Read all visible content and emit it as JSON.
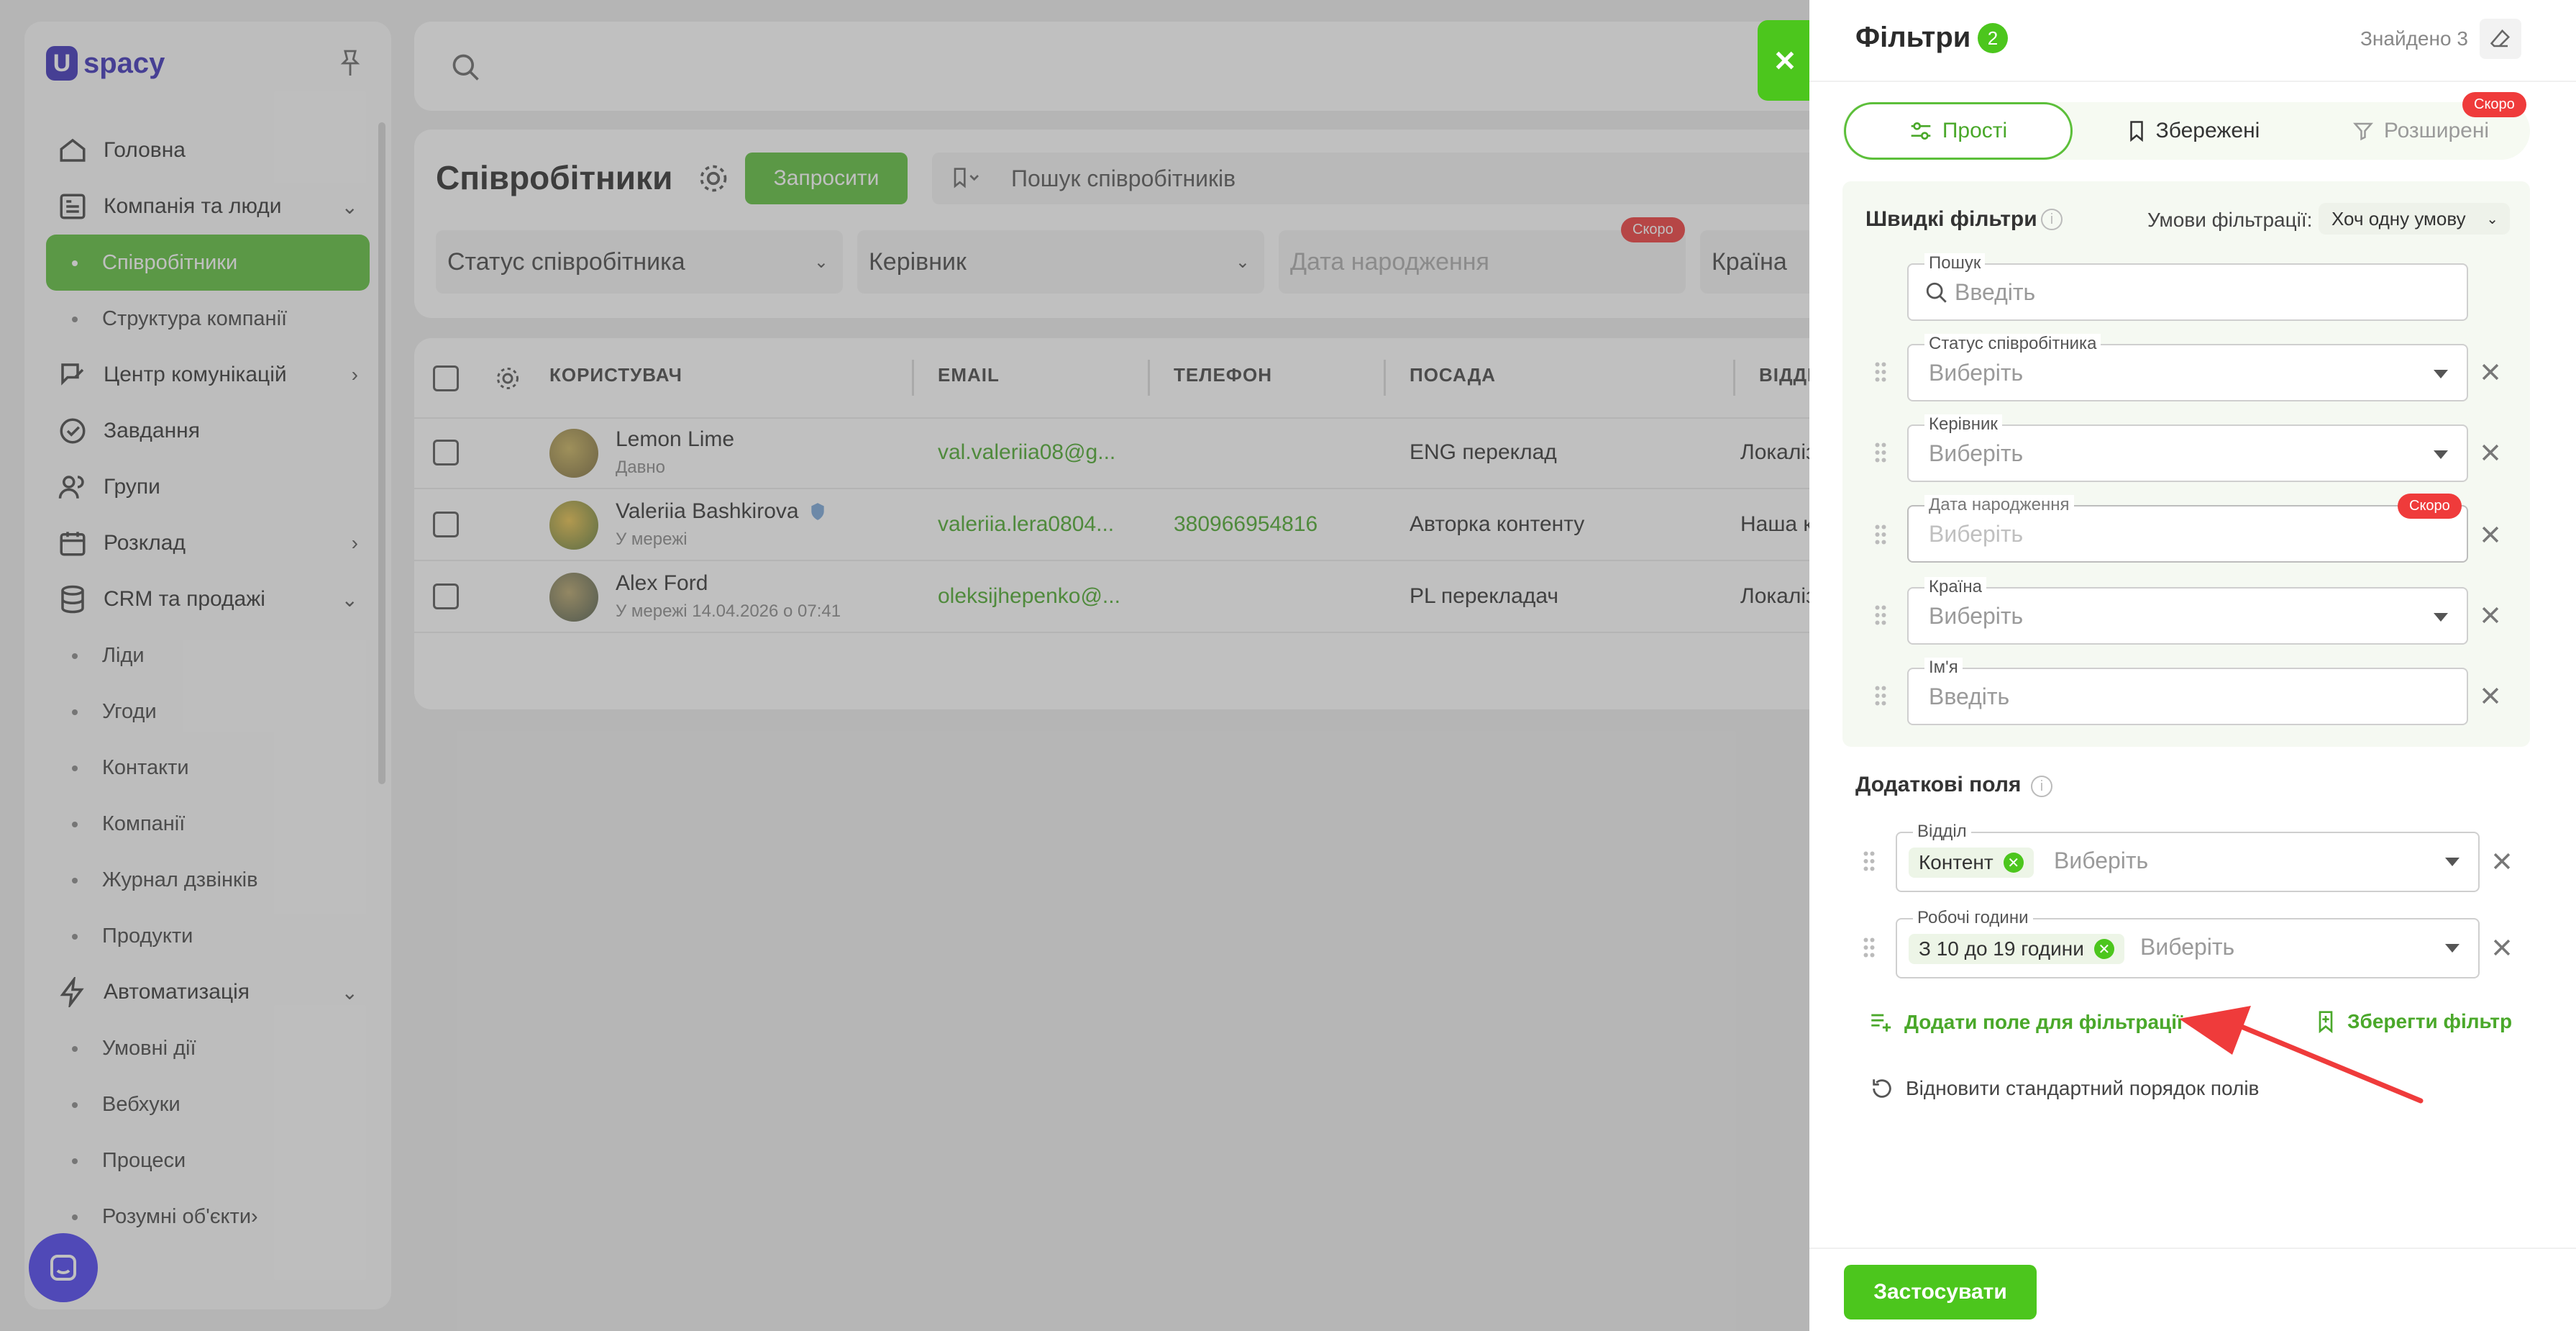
{
  "brand": {
    "logo_mark": "U",
    "logo_text": "spacy"
  },
  "sidebar": {
    "items": [
      {
        "label": "Головна",
        "icon": "home-icon",
        "type": "item"
      },
      {
        "label": "Компанія та люди",
        "icon": "building-icon",
        "type": "item",
        "chevron": "⌄"
      },
      {
        "label": "Співробітники",
        "type": "sub",
        "active": true
      },
      {
        "label": "Структура компанії",
        "type": "sub"
      },
      {
        "label": "Центр комунікацій",
        "icon": "chat-edit-icon",
        "type": "item",
        "chevron": "›"
      },
      {
        "label": "Завдання",
        "icon": "check-circle-icon",
        "type": "item"
      },
      {
        "label": "Групи",
        "icon": "users-icon",
        "type": "item"
      },
      {
        "label": "Розклад",
        "icon": "calendar-icon",
        "type": "item",
        "chevron": "›"
      },
      {
        "label": "CRM та продажі",
        "icon": "database-icon",
        "type": "item",
        "chevron": "⌄"
      },
      {
        "label": "Ліди",
        "type": "sub"
      },
      {
        "label": "Угоди",
        "type": "sub"
      },
      {
        "label": "Контакти",
        "type": "sub"
      },
      {
        "label": "Компанії",
        "type": "sub"
      },
      {
        "label": "Журнал дзвінків",
        "type": "sub"
      },
      {
        "label": "Продукти",
        "type": "sub"
      },
      {
        "label": "Автоматизація",
        "icon": "bolt-icon",
        "type": "item",
        "chevron": "⌄"
      },
      {
        "label": "Умовні дії",
        "type": "sub"
      },
      {
        "label": "Вебхуки",
        "type": "sub"
      },
      {
        "label": "Процеси",
        "type": "sub"
      },
      {
        "label": "Розумні об'єкти",
        "type": "sub",
        "chevron": "›"
      }
    ]
  },
  "page": {
    "title": "Співробітники",
    "invite_label": "Запросити",
    "search_placeholder": "Пошук співробітників",
    "filters": [
      {
        "label": "Статус співробітника"
      },
      {
        "label": "Керівник"
      },
      {
        "label": "Дата народження",
        "badge": "Скоро"
      },
      {
        "label": "Країна"
      }
    ]
  },
  "table": {
    "columns": [
      "КОРИСТУВАЧ",
      "EMAIL",
      "ТЕЛЕФОН",
      "ПОСАДА",
      "ВІДДІ"
    ],
    "rows": [
      {
        "name": "Lemon Lime",
        "status": "Давно",
        "email": "val.valeriia08@g...",
        "phone": "",
        "position": "ENG переклад",
        "dept": "Локаліз"
      },
      {
        "name": "Valeriia Bashkirova",
        "status": "У мережі",
        "email": "valeriia.lera0804...",
        "phone": "380966954816",
        "position": "Авторка контенту",
        "dept": "Наша к"
      },
      {
        "name": "Alex Ford",
        "status": "У мережі 14.04.2026 о 07:41",
        "email": "oleksijhepenko@...",
        "phone": "",
        "position": "PL перекладач",
        "dept": "Локаліз"
      }
    ]
  },
  "panel": {
    "title": "Фільтри",
    "count": "2",
    "found": "Знайдено 3",
    "tabs": [
      {
        "label": "Прості",
        "icon": "sliders-icon",
        "state": "active"
      },
      {
        "label": "Збережені",
        "icon": "bookmark-icon",
        "state": "normal"
      },
      {
        "label": "Розширені",
        "icon": "funnel-icon",
        "state": "disabled",
        "badge": "Скоро"
      }
    ],
    "quick": {
      "title": "Швидкі фільтри",
      "condition_label": "Умови фільтрації:",
      "condition_value": "Хоч одну умову",
      "fields": [
        {
          "label": "Пошук",
          "placeholder": "Введіть",
          "kind": "search"
        },
        {
          "label": "Статус співробітника",
          "placeholder": "Виберіть",
          "kind": "select"
        },
        {
          "label": "Керівник",
          "placeholder": "Виберіть",
          "kind": "select"
        },
        {
          "label": "Дата народження",
          "placeholder": "Виберіть",
          "kind": "disabled",
          "badge": "Скоро"
        },
        {
          "label": "Країна",
          "placeholder": "Виберіть",
          "kind": "select"
        },
        {
          "label": "Ім'я",
          "placeholder": "Введіть",
          "kind": "text"
        }
      ]
    },
    "extra": {
      "title": "Додаткові поля",
      "fields": [
        {
          "label": "Відділ",
          "chip": "Контент",
          "placeholder": "Виберіть"
        },
        {
          "label": "Робочі години",
          "chip": "З 10 до 19 години",
          "placeholder": "Виберіть"
        }
      ]
    },
    "add_field_label": "Додати поле для фільтрації",
    "save_filter_label": "Зберегти фільтр",
    "reset_order_label": "Відновити стандартний порядок полів",
    "apply_label": "Застосувати"
  },
  "colors": {
    "accent": "#4cc61d",
    "accent_text": "#4aa82a",
    "danger": "#ef3b3b",
    "brand": "#3a2fb8"
  }
}
